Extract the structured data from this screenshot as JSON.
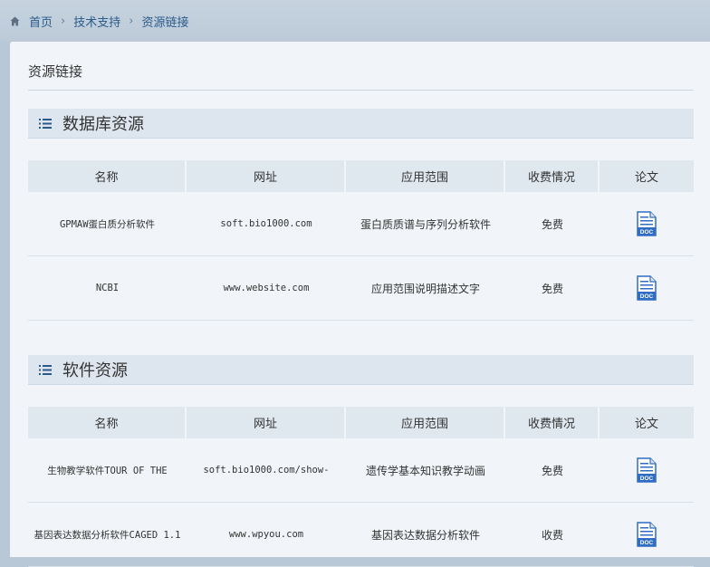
{
  "breadcrumb": {
    "items": [
      "首页",
      "技术支持",
      "资源链接"
    ]
  },
  "page_title": "资源链接",
  "columns": [
    "名称",
    "网址",
    "应用范围",
    "收费情况",
    "论文"
  ],
  "sections": [
    {
      "title": "数据库资源",
      "rows": [
        {
          "name": "GPMAW蛋白质分析软件",
          "url": "soft.bio1000.com",
          "scope": "蛋白质质谱与序列分析软件",
          "fee": "免费",
          "paper_icon": "doc-icon"
        },
        {
          "name": "NCBI",
          "url": "www.website.com",
          "scope": "应用范围说明描述文字",
          "fee": "免费",
          "paper_icon": "doc-icon"
        }
      ]
    },
    {
      "title": "软件资源",
      "rows": [
        {
          "name": "生物教学软件TOUR OF THE",
          "url": "soft.bio1000.com/show-",
          "scope": "遗传学基本知识教学动画",
          "fee": "免费",
          "paper_icon": "doc-icon"
        },
        {
          "name": "基因表达数据分析软件CAGED 1.1",
          "url": "www.wpyou.com",
          "scope": "基因表达数据分析软件",
          "fee": "收费",
          "paper_icon": "doc-icon"
        }
      ]
    }
  ],
  "colors": {
    "accent": "#2a5a8a",
    "doc_blue": "#2f6cc4",
    "header_bg": "#dde6ee"
  }
}
